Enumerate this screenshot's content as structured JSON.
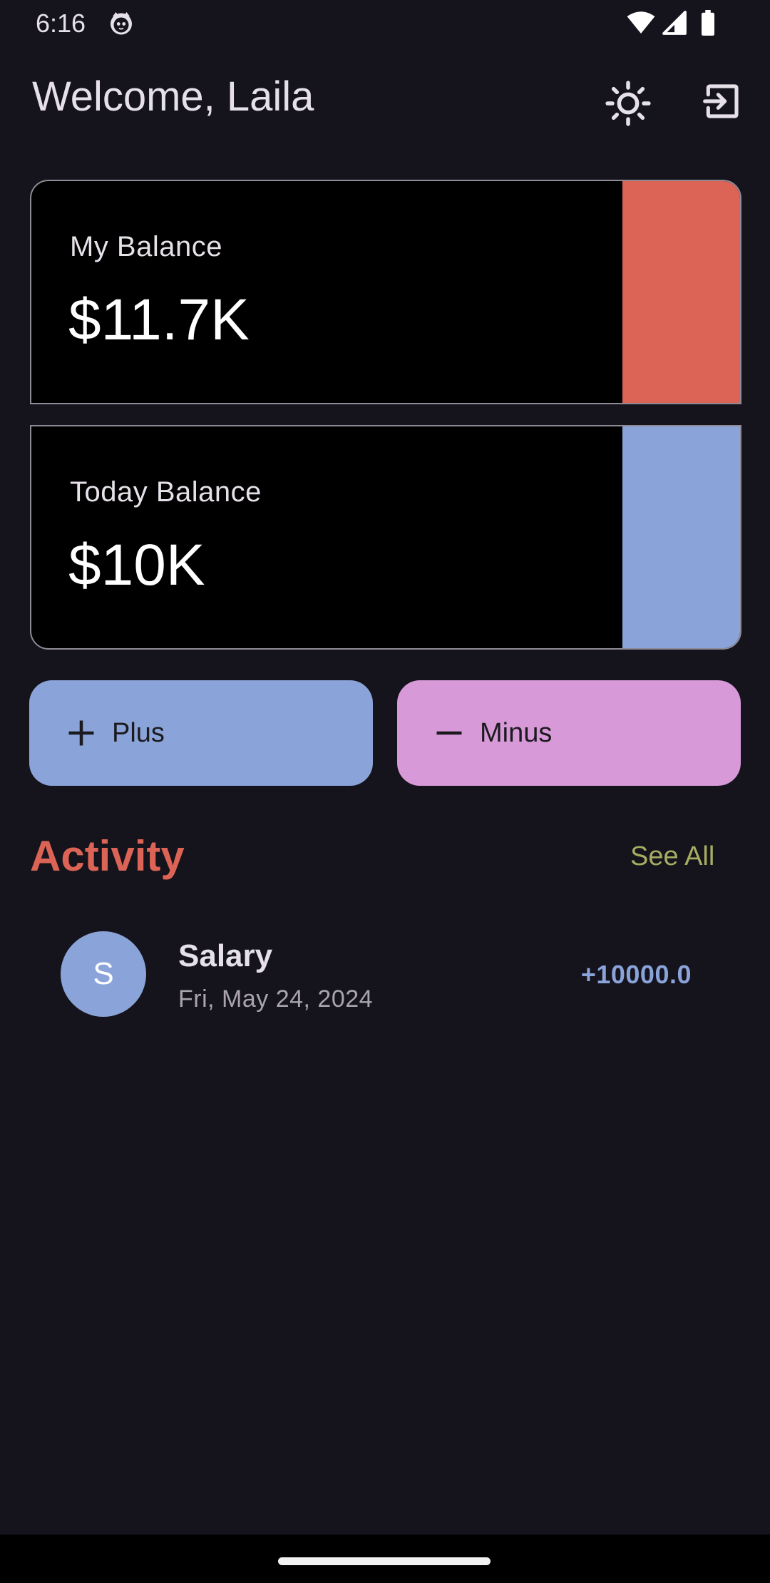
{
  "status_bar": {
    "time": "6:16",
    "icons": [
      "cat-icon",
      "wifi-icon",
      "signal-icon",
      "battery-icon"
    ]
  },
  "header": {
    "welcome": "Welcome, Laila",
    "theme_icon": "sun-icon",
    "logout_icon": "exit-icon"
  },
  "cards": [
    {
      "label": "My Balance",
      "value": "$11.7K",
      "accent": "#db6456"
    },
    {
      "label": "Today Balance",
      "value": "$10K",
      "accent": "#8aa4da"
    }
  ],
  "actions": {
    "plus": {
      "label": "Plus",
      "icon": "plus-icon",
      "color": "#8aa4da"
    },
    "minus": {
      "label": "Minus",
      "icon": "minus-icon",
      "color": "#d899d9"
    }
  },
  "activity": {
    "title": "Activity",
    "see_all": "See All",
    "transactions": [
      {
        "initial": "S",
        "title": "Salary",
        "date": "Fri, May 24, 2024",
        "amount": "+10000.0"
      }
    ]
  },
  "colors": {
    "background": "#15131b",
    "accent_red": "#db6456",
    "accent_blue": "#8aa4da",
    "accent_pink": "#d899d9",
    "see_all": "#a6ad62"
  }
}
